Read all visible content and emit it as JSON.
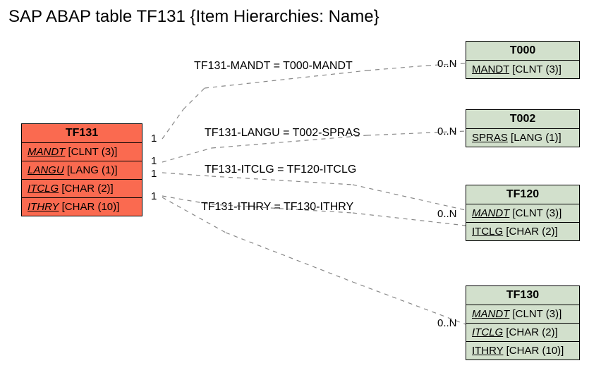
{
  "title": "SAP ABAP table TF131 {Item Hierarchies: Name}",
  "main_entity": {
    "name": "TF131",
    "fields": [
      {
        "name": "MANDT",
        "type": "[CLNT (3)]"
      },
      {
        "name": "LANGU",
        "type": "[LANG (1)]"
      },
      {
        "name": "ITCLG",
        "type": "[CHAR (2)]"
      },
      {
        "name": "ITHRY",
        "type": "[CHAR (10)]"
      }
    ]
  },
  "ref_entities": {
    "t000": {
      "name": "T000",
      "fields": [
        {
          "name": "MANDT",
          "type": "[CLNT (3)]"
        }
      ]
    },
    "t002": {
      "name": "T002",
      "fields": [
        {
          "name": "SPRAS",
          "type": "[LANG (1)]"
        }
      ]
    },
    "tf120": {
      "name": "TF120",
      "fields": [
        {
          "name": "MANDT",
          "type": "[CLNT (3)]"
        },
        {
          "name": "ITCLG",
          "type": "[CHAR (2)]"
        }
      ]
    },
    "tf130": {
      "name": "TF130",
      "fields": [
        {
          "name": "MANDT",
          "type": "[CLNT (3)]"
        },
        {
          "name": "ITCLG",
          "type": "[CHAR (2)]"
        },
        {
          "name": "ITHRY",
          "type": "[CHAR (10)]"
        }
      ]
    }
  },
  "relations": {
    "r1": {
      "label": "TF131-MANDT = T000-MANDT",
      "left": "1",
      "right": "0..N"
    },
    "r2": {
      "label": "TF131-LANGU = T002-SPRAS",
      "left": "1",
      "right": "0..N"
    },
    "r3": {
      "label": "TF131-ITCLG = TF120-ITCLG",
      "left": "1",
      "right": ""
    },
    "r4": {
      "label": "TF131-ITHRY = TF130-ITHRY",
      "left": "1",
      "right": "0..N"
    },
    "r5": {
      "left": "",
      "right": "0..N"
    }
  },
  "chart_data": {
    "type": "table",
    "description": "Entity-relationship diagram for SAP ABAP table TF131",
    "main_table": "TF131",
    "main_fields": [
      {
        "field": "MANDT",
        "datatype": "CLNT",
        "len": 3,
        "key": true
      },
      {
        "field": "LANGU",
        "datatype": "LANG",
        "len": 1,
        "key": true
      },
      {
        "field": "ITCLG",
        "datatype": "CHAR",
        "len": 2,
        "key": true
      },
      {
        "field": "ITHRY",
        "datatype": "CHAR",
        "len": 10,
        "key": true
      }
    ],
    "related_tables": [
      {
        "table": "T000",
        "join": "TF131-MANDT = T000-MANDT",
        "cardinality": "1 : 0..N",
        "fields": [
          {
            "field": "MANDT",
            "datatype": "CLNT",
            "len": 3
          }
        ]
      },
      {
        "table": "T002",
        "join": "TF131-LANGU = T002-SPRAS",
        "cardinality": "1 : 0..N",
        "fields": [
          {
            "field": "SPRAS",
            "datatype": "LANG",
            "len": 1
          }
        ]
      },
      {
        "table": "TF120",
        "join": "TF131-ITCLG = TF120-ITCLG",
        "cardinality": "1 : 0..N",
        "fields": [
          {
            "field": "MANDT",
            "datatype": "CLNT",
            "len": 3
          },
          {
            "field": "ITCLG",
            "datatype": "CHAR",
            "len": 2
          }
        ]
      },
      {
        "table": "TF130",
        "join": "TF131-ITHRY = TF130-ITHRY",
        "cardinality": "1 : 0..N",
        "fields": [
          {
            "field": "MANDT",
            "datatype": "CLNT",
            "len": 3
          },
          {
            "field": "ITCLG",
            "datatype": "CHAR",
            "len": 2
          },
          {
            "field": "ITHRY",
            "datatype": "CHAR",
            "len": 10
          }
        ]
      }
    ]
  }
}
